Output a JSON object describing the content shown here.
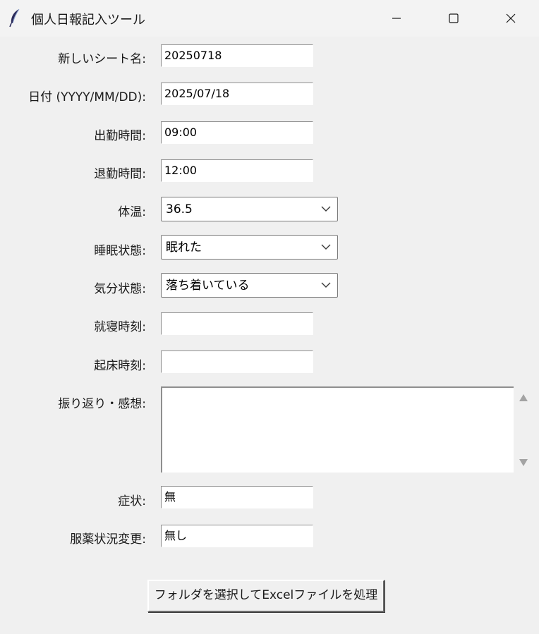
{
  "window": {
    "title": "個人日報記入ツール",
    "icon": "feather-icon",
    "controls": [
      "minimize-icon",
      "maximize-icon",
      "close-icon"
    ]
  },
  "form": {
    "sheet_name": {
      "label": "新しいシート名:",
      "value": "20250718"
    },
    "date": {
      "label": "日付 (YYYY/MM/DD):",
      "value": "2025/07/18"
    },
    "start_time": {
      "label": "出勤時間:",
      "value": "09:00"
    },
    "end_time": {
      "label": "退勤時間:",
      "value": "12:00"
    },
    "temperature": {
      "label": "体温:",
      "value": "36.5"
    },
    "sleep_state": {
      "label": "睡眠状態:",
      "value": "眠れた"
    },
    "mood_state": {
      "label": "気分状態:",
      "value": "落ち着いている"
    },
    "bed_time": {
      "label": "就寝時刻:",
      "value": ""
    },
    "wake_time": {
      "label": "起床時刻:",
      "value": ""
    },
    "reflection": {
      "label": "振り返り・感想:",
      "value": ""
    },
    "symptoms": {
      "label": "症状:",
      "value": "無"
    },
    "medication_change": {
      "label": "服薬状況変更:",
      "value": "無し"
    }
  },
  "action": {
    "process_label": "フォルダを選択してExcelファイルを処理"
  }
}
